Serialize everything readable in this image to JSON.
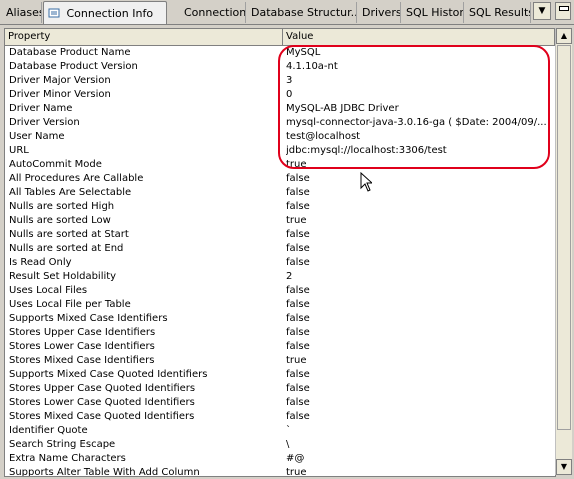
{
  "tabs": [
    {
      "label": "Aliases"
    },
    {
      "label": "Connection Info"
    },
    {
      "label": "Connections"
    },
    {
      "label": "Database Structur..."
    },
    {
      "label": "Drivers"
    },
    {
      "label": "SQL History"
    },
    {
      "label": "SQL Results"
    }
  ],
  "tab_close_glyph": "✕",
  "table": {
    "columns": [
      "Property",
      "Value"
    ],
    "rows": [
      {
        "property": "Database Product Name",
        "value": "MySQL"
      },
      {
        "property": "Database Product Version",
        "value": "4.1.10a-nt"
      },
      {
        "property": "Driver Major Version",
        "value": "3"
      },
      {
        "property": "Driver Minor Version",
        "value": "0"
      },
      {
        "property": "Driver Name",
        "value": "MySQL-AB JDBC Driver"
      },
      {
        "property": "Driver Version",
        "value": "mysql-connector-java-3.0.16-ga ( $Date: 2004/09/..."
      },
      {
        "property": "User Name",
        "value": "test@localhost"
      },
      {
        "property": "URL",
        "value": "jdbc:mysql://localhost:3306/test"
      },
      {
        "property": "AutoCommit Mode",
        "value": "true"
      },
      {
        "property": "All Procedures Are Callable",
        "value": "false"
      },
      {
        "property": "All Tables Are Selectable",
        "value": "false"
      },
      {
        "property": "Nulls are sorted High",
        "value": "false"
      },
      {
        "property": "Nulls are sorted Low",
        "value": "true"
      },
      {
        "property": "Nulls are sorted at Start",
        "value": "false"
      },
      {
        "property": "Nulls are sorted at End",
        "value": "false"
      },
      {
        "property": "Is Read Only",
        "value": "false"
      },
      {
        "property": "Result Set Holdability",
        "value": "2"
      },
      {
        "property": "Uses Local Files",
        "value": "false"
      },
      {
        "property": "Uses Local File per Table",
        "value": "false"
      },
      {
        "property": "Supports Mixed Case Identifiers",
        "value": "false"
      },
      {
        "property": "Stores Upper Case Identifiers",
        "value": "false"
      },
      {
        "property": "Stores Lower Case Identifiers",
        "value": "false"
      },
      {
        "property": "Stores Mixed Case Identifiers",
        "value": "true"
      },
      {
        "property": "Supports Mixed Case Quoted Identifiers",
        "value": "false"
      },
      {
        "property": "Stores Upper Case Quoted Identifiers",
        "value": "false"
      },
      {
        "property": "Stores Lower Case Quoted Identifiers",
        "value": "false"
      },
      {
        "property": "Stores Mixed Case Quoted Identifiers",
        "value": "false"
      },
      {
        "property": "Identifier Quote",
        "value": "`"
      },
      {
        "property": "Search String Escape",
        "value": "\\"
      },
      {
        "property": "Extra Name Characters",
        "value": "#@"
      },
      {
        "property": "Supports Alter Table With Add Column",
        "value": "true"
      }
    ]
  },
  "colors": {
    "highlight": "#e0001b",
    "header_bg": "#ece9d8",
    "window_bg": "#d4d0c8"
  }
}
